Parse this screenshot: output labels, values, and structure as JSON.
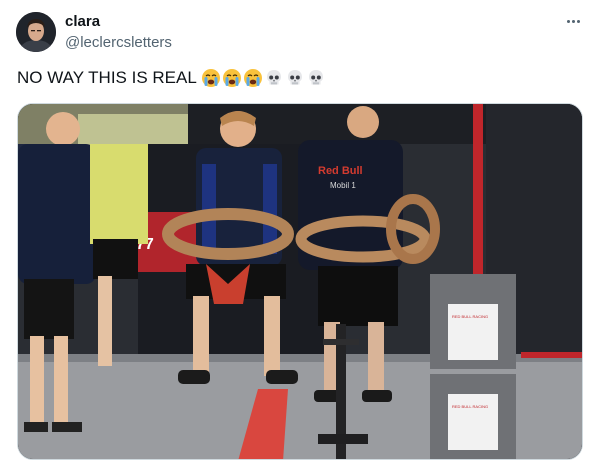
{
  "author": {
    "display_name": "clara",
    "handle": "@leclercsletters",
    "avatar_icon": "profile-avatar"
  },
  "tweet": {
    "text": "NO WAY THIS IS REAL",
    "emojis": [
      "loudly-crying-face",
      "loudly-crying-face",
      "loudly-crying-face",
      "skull",
      "skull",
      "skull"
    ]
  },
  "menu": {
    "icon": "more-options-icon"
  },
  "media": {
    "description_icon": "photo",
    "car_number": "77",
    "team_text": "Red Bull",
    "team_subtext": "Mobil 1",
    "crate_label": "RED BULL RACING"
  },
  "colors": {
    "accent_text": "#0f1419",
    "muted_text": "#536471",
    "border": "#cfd9de"
  }
}
